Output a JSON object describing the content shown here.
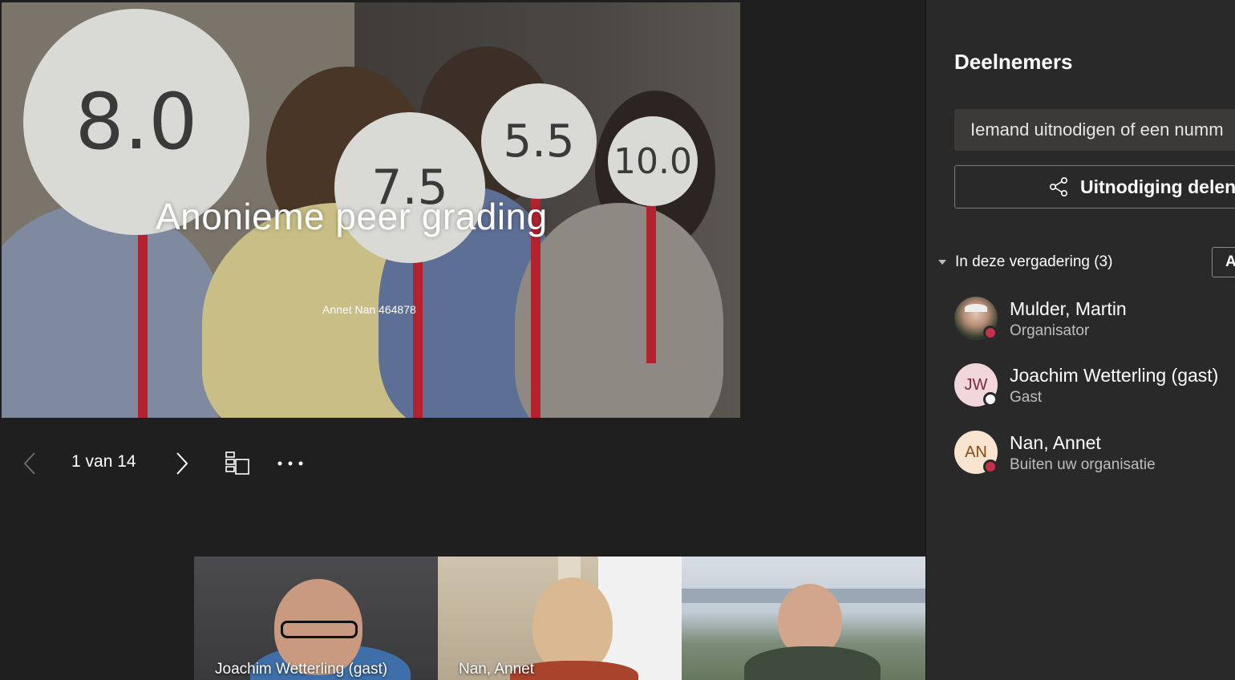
{
  "slide": {
    "title": "Anonieme peer grading",
    "subtitle": "Annet Nan 464878",
    "paddles": [
      "8.0",
      "7.5",
      "5.5",
      "10.0"
    ]
  },
  "controls": {
    "page_indicator": "1 van 14",
    "current_page": 1,
    "total_pages": 14,
    "prev_icon": "chevron-left-icon",
    "next_icon": "chevron-right-icon",
    "thumbnails_icon": "slide-thumbnails-icon",
    "more_icon": "more-options-icon"
  },
  "videos": [
    {
      "name": "Joachim Wetterling (gast)"
    },
    {
      "name": "Nan, Annet"
    },
    {
      "name": ""
    }
  ],
  "panel": {
    "title": "Deelnemers",
    "invite_placeholder": "Iemand uitnodigen of een numm",
    "share_label": "Uitnodiging delen",
    "share_icon": "share-icon",
    "section_label": "In deze vergadering (3)",
    "admit_label": "A",
    "participants": [
      {
        "name": "Mulder, Martin",
        "role": "Organisator",
        "initials": "",
        "status": "busy",
        "status_color": "#c4314b"
      },
      {
        "name": "Joachim Wetterling (gast)",
        "role": "Gast",
        "initials": "JW",
        "status": "unknown",
        "status_color": "#ffffff"
      },
      {
        "name": "Nan, Annet",
        "role": "Buiten uw organisatie",
        "initials": "AN",
        "status": "busy",
        "status_color": "#c4314b"
      }
    ]
  },
  "colors": {
    "background": "#1f1f1f",
    "panel": "#292929",
    "busy": "#c4314b"
  }
}
